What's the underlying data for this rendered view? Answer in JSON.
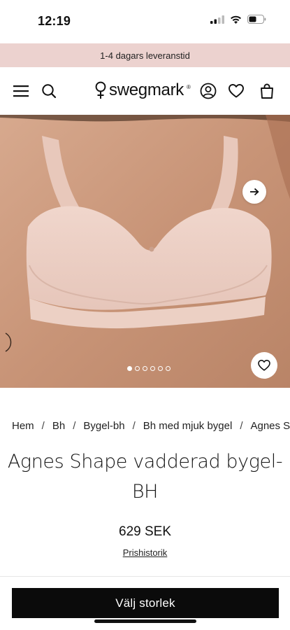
{
  "status": {
    "time": "12:19"
  },
  "promo": {
    "text": "1-4 dagars leveranstid"
  },
  "header": {
    "logo": "swegmark",
    "logo_mark": "®",
    "icons": [
      "menu-icon",
      "search-icon",
      "account-icon",
      "heart-icon",
      "bag-icon"
    ]
  },
  "gallery": {
    "image_count": 6,
    "active_index": 0
  },
  "breadcrumb": [
    "Hem",
    "Bh",
    "Bygel-bh",
    "Bh med mjuk bygel",
    "Agnes Shape vadderad bygel-BH"
  ],
  "product": {
    "title": "Agnes Shape vadderad bygel-BH",
    "price": "629 SEK",
    "price_history": "Prishistorik"
  },
  "cta": {
    "label": "Välj storlek"
  },
  "colors": {
    "promo_bg": "#ecd2cf",
    "cta_bg": "#0b0b0b",
    "accent_skin": "#c9957a"
  }
}
